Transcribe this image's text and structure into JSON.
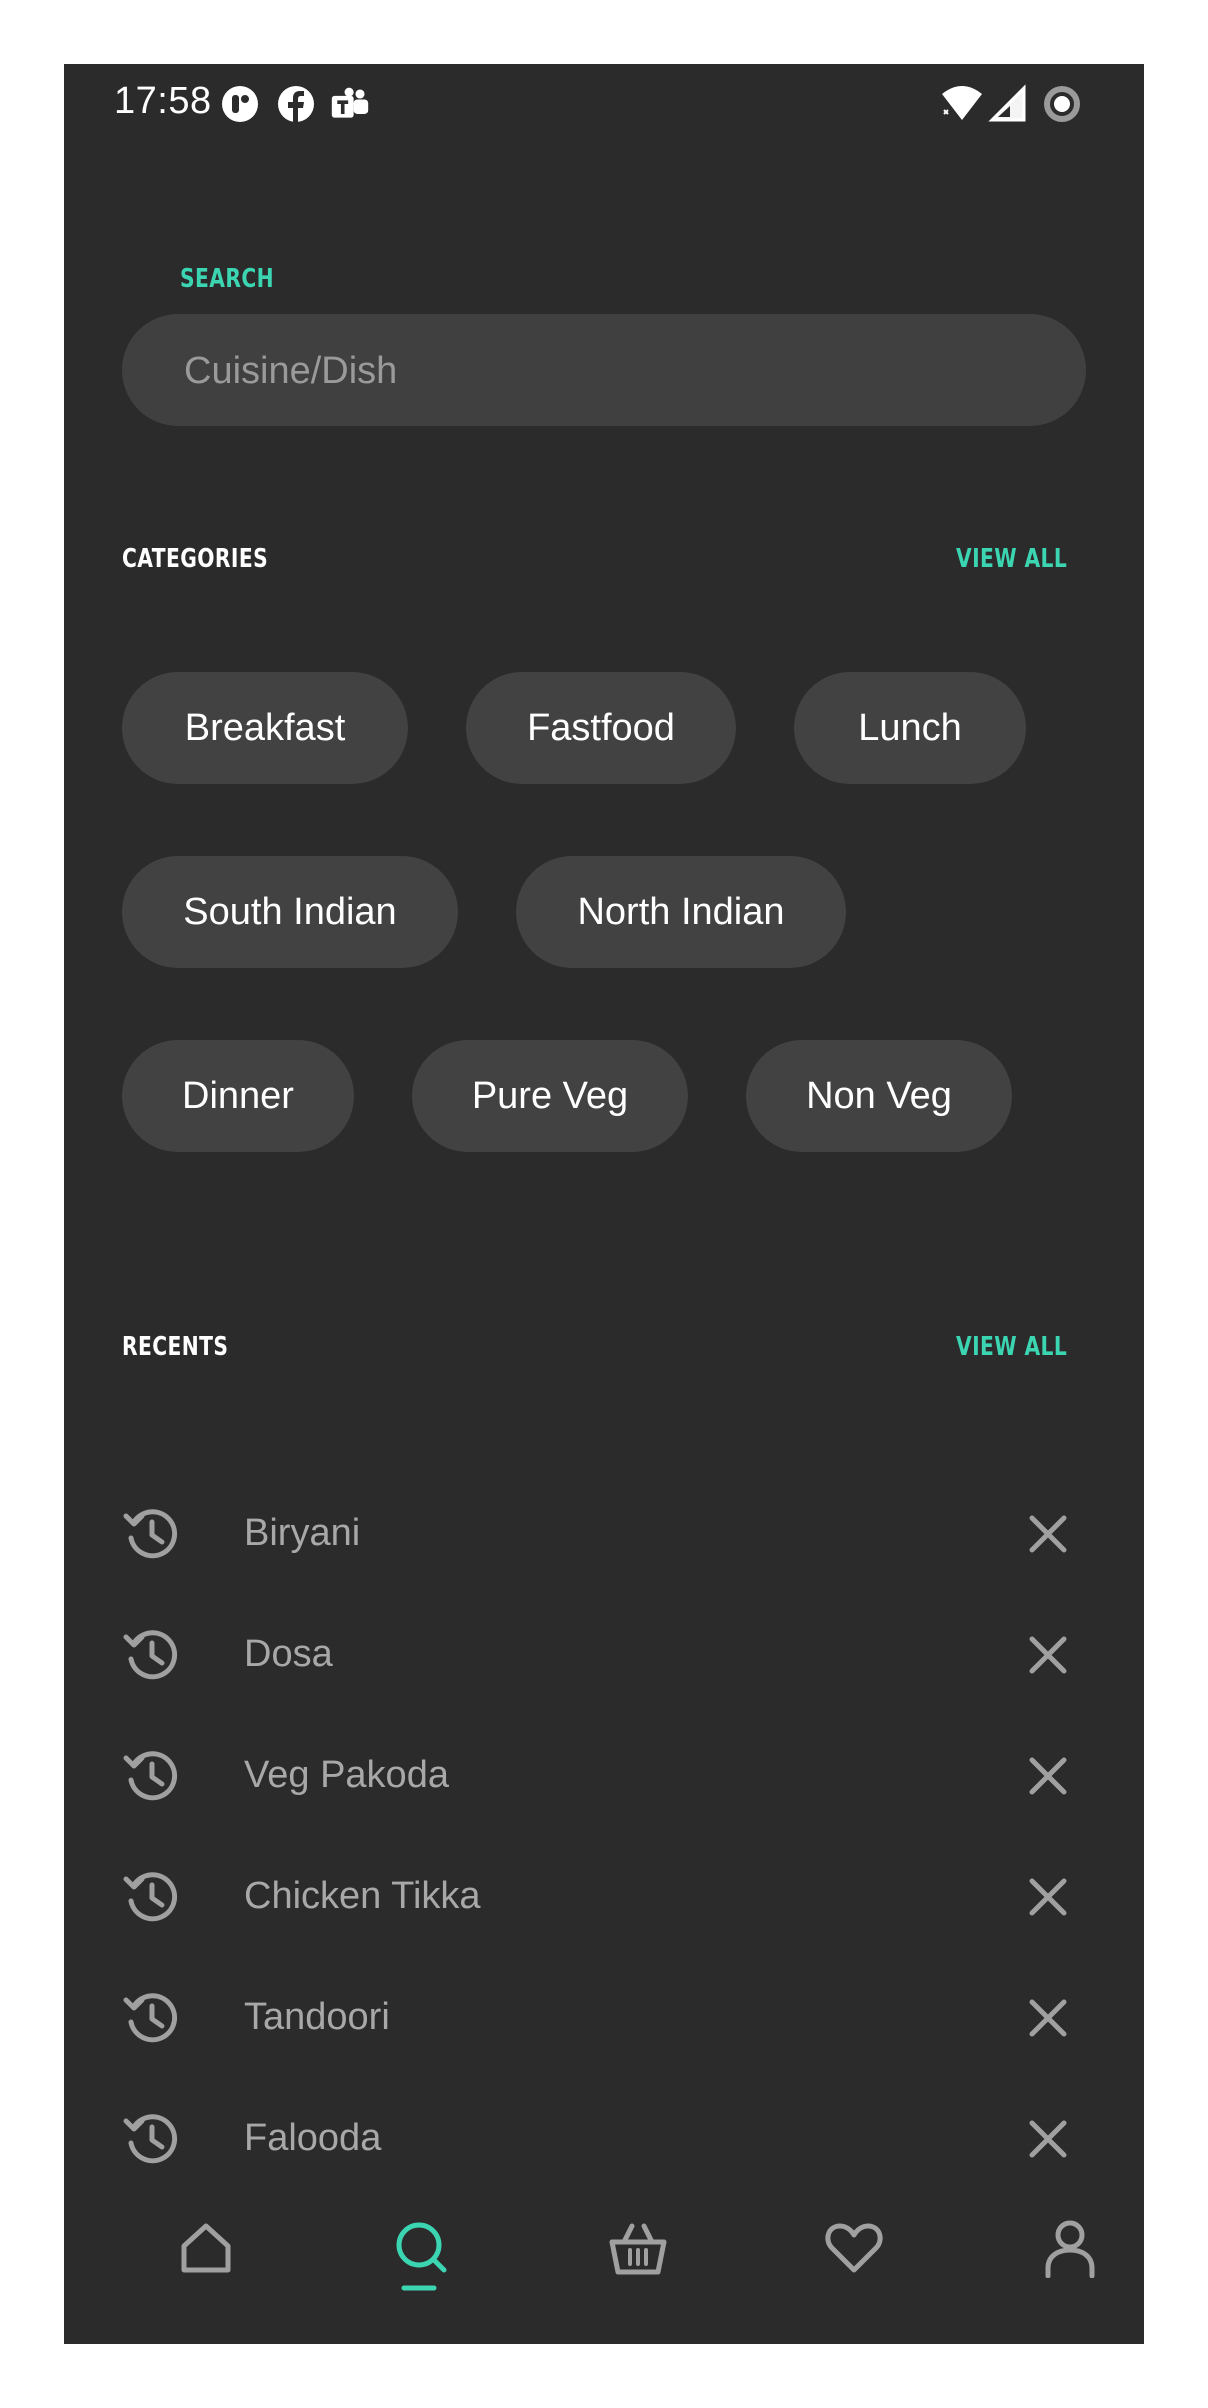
{
  "status_bar": {
    "time": "17:58",
    "notification_icons": [
      "circle-app-icon",
      "facebook-icon",
      "teams-icon"
    ],
    "system_icons": [
      "wifi-icon",
      "signal-icon",
      "data-saver-icon"
    ]
  },
  "search": {
    "label": "SEARCH",
    "placeholder": "Cuisine/Dish",
    "value": ""
  },
  "categories": {
    "title": "CATEGORIES",
    "view_all": "VIEW ALL",
    "items": [
      "Breakfast",
      "Fastfood",
      "Lunch",
      "South Indian",
      "North Indian",
      "Dinner",
      "Pure Veg",
      "Non Veg"
    ]
  },
  "recents": {
    "title": "RECENTS",
    "view_all": "VIEW ALL",
    "items": [
      "Biryani",
      "Dosa",
      "Veg Pakoda",
      "Chicken Tikka",
      "Tandoori",
      "Falooda"
    ]
  },
  "bottom_nav": {
    "items": [
      {
        "icon": "home-icon",
        "active": false
      },
      {
        "icon": "search-icon",
        "active": true
      },
      {
        "icon": "basket-icon",
        "active": false
      },
      {
        "icon": "heart-icon",
        "active": false
      },
      {
        "icon": "profile-icon",
        "active": false
      }
    ]
  },
  "colors": {
    "accent": "#3cd5b2",
    "background": "#2b2b2b",
    "chip": "#424242",
    "muted_text": "#a8a8a8"
  }
}
